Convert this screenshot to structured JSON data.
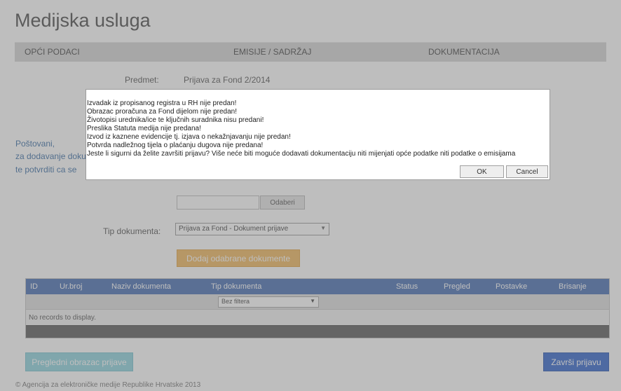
{
  "app": {
    "title": "Medijska usluga"
  },
  "tabs": [
    {
      "label": "OPĆI PODACI"
    },
    {
      "label": "EMISIJE / SADRŽAJ"
    },
    {
      "label": "DOKUMENTACIJA"
    }
  ],
  "predmet": {
    "label": "Predmet:",
    "value": "Prijava za Fond 2/2014"
  },
  "notice": {
    "line1": "Poštovani,",
    "line2": "za dodavanje doku",
    "line3": "te potvrditi ca se"
  },
  "upload": {
    "browse_label": "Odaberi"
  },
  "doc_type": {
    "label": "Tip dokumenta:",
    "selected": "Prijava za Fond - Dokument prijave"
  },
  "add_button": {
    "label": "Dodaj odabrane dokumente"
  },
  "grid": {
    "columns": [
      "ID",
      "Ur.broj",
      "Naziv dokumenta",
      "Tip dokumenta",
      "Status",
      "Pregled",
      "Postavke",
      "Brisanje"
    ],
    "filter": {
      "selected": "Bez filtera"
    },
    "empty_message": "No records to display."
  },
  "footer": {
    "prev_button": "Pregledni obrazac prijave",
    "finish_button": "Završi prijavu",
    "copyright": "© Agencija za elektroničke medije Republike Hrvatske 2013"
  },
  "dialog": {
    "lines": [
      "Izvadak iz propisanog registra u RH nije predan!",
      "Obrazac proračuna za Fond dijelom nije predan!",
      "Životopisi urednika/ice te ključnih suradnika nisu predani!",
      "Preslika Statuta medija nije predana!",
      "Izvod iz kaznene evidencije tj. izjava o nekažnjavanju nije predan!",
      "Potvrda nadležnog tijela o plaćanju dugova nije predana!",
      "Jeste li sigurni da želite završiti prijavu? Više neće biti moguće dodavati dokumentaciju niti mijenjati opće podatke niti podatke o emisijama"
    ],
    "ok_label": "OK",
    "cancel_label": "Cancel"
  }
}
